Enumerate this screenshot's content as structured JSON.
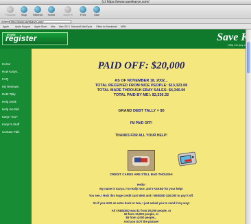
{
  "browser": {
    "window_title": "(c) https://www.savekaryn.com/",
    "toolbar": {
      "back": "Forward",
      "stop": "Stop",
      "refresh": "Refresh",
      "home": "Home",
      "autofill": "AutoFill",
      "print": "Print",
      "mail": "Mail"
    },
    "address": {
      "label": "Address",
      "value": "http://www.savekaryn.com/"
    },
    "favorites": [
      "Apple",
      "Apple Support",
      "Apple Store",
      "Mac",
      "Mac OS X",
      "Microsoft MacTopia",
      "Office for Macintosh",
      "MSN"
    ]
  },
  "site": {
    "logo_text": "register",
    "logo_suffix": ".com",
    "brand": "Save K",
    "tagline": "Help me pay off",
    "sidebar": [
      "Home",
      "How Karyn..",
      "FAQ",
      "My Reviews",
      "Debt Tally",
      "Help Desk",
      "Help me Bid",
      "Karyn Too?",
      "Karyn's Stuff",
      "Contact Pals"
    ]
  },
  "content": {
    "headline": "PAID OFF: $20,000",
    "asof": "AS OF NOVEMBER 18, 2002...",
    "received": "TOTAL RECEIVED FROM NICE PEOPLE: $13,323.08",
    "ebay": "TOTAL MADE THROUGH EBAY SALES: $4,340.00",
    "total": "TOTAL PAID BY ME!: $2,336.32",
    "tally": "GRAND DEBT TALLY = $0",
    "paid_off": "I'M PAID OFF!",
    "thanks": "THANKS FOR ALL YOUR HELP!",
    "caption": "CREDIT CARDS ARE STILL BAD THOUGH!",
    "hello": "Hello!",
    "intro": "My name is Karyn, I'm really nice, and I ASKED for your help!",
    "debt": "You see, I HAD this huge credit card debt and I NEEDED $20,000 to pay it off.",
    "ask": "So if you HAD an extra buck or two, I just asked you to send it my way!",
    "math1": "All I NEEDED was $1 from 20,000 people, or",
    "math2": "$2 from 10,000 people, or",
    "math3": "$5 from 4,000 people...",
    "picture": "And you GOT the picture!"
  },
  "colors": {
    "page_bg": "#f3e77e",
    "header_green": "#0f7a2c",
    "text_blue": "#1c1c7a"
  }
}
